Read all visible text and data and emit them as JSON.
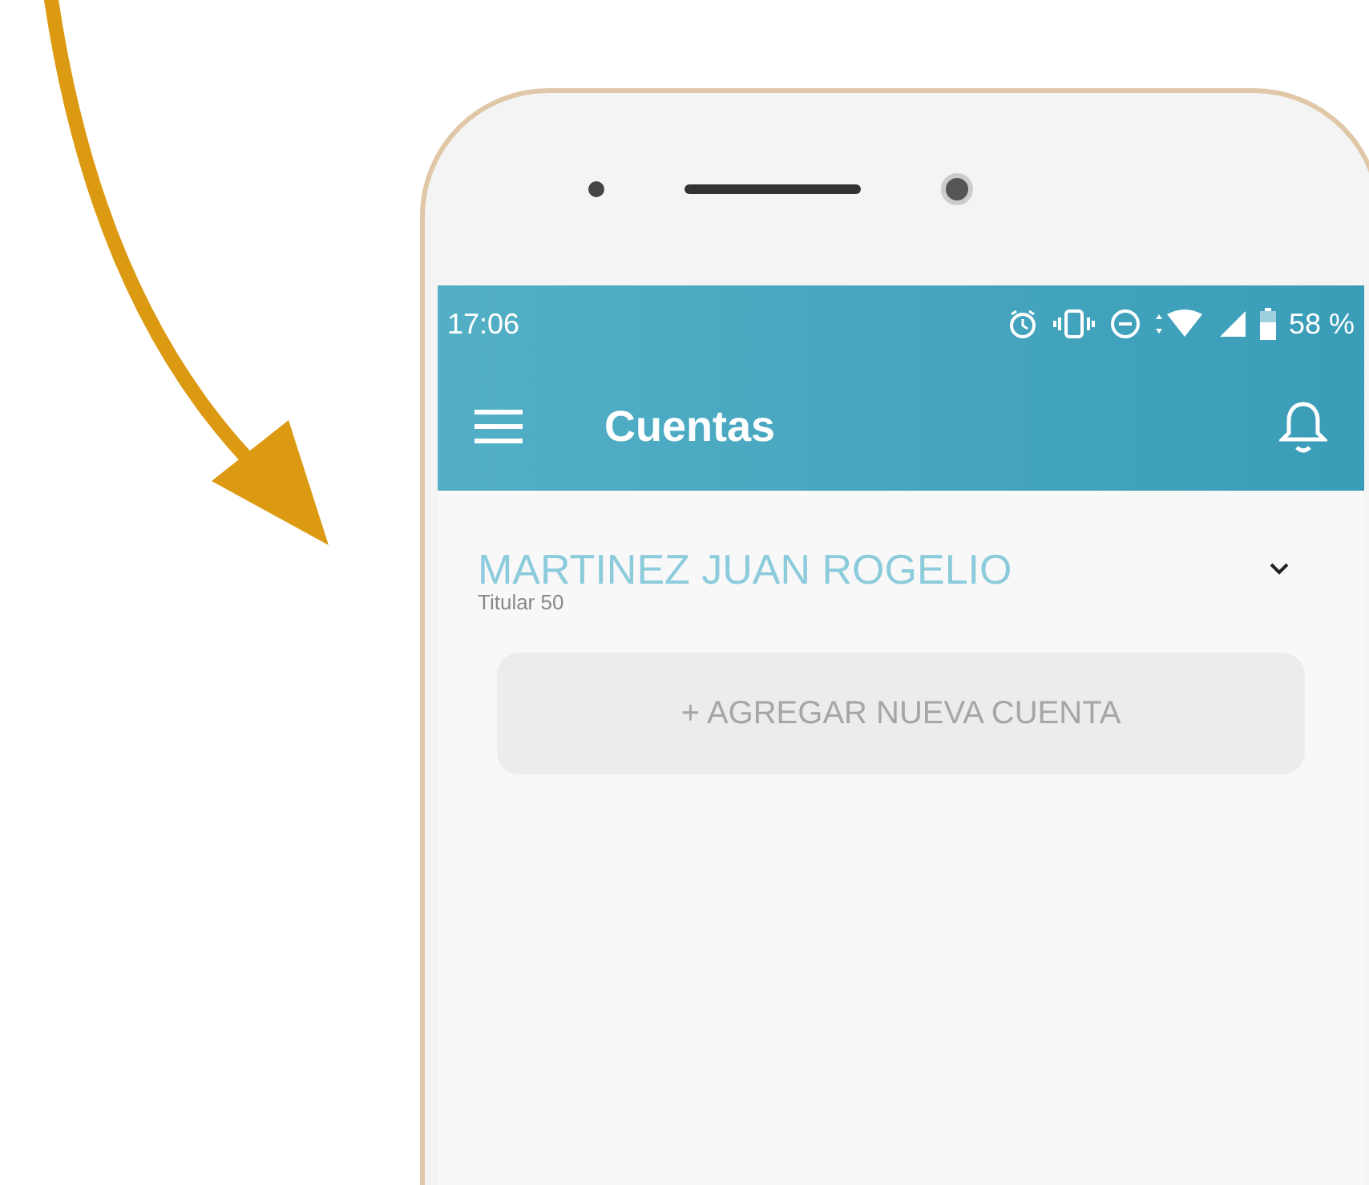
{
  "status_bar": {
    "time": "17:06",
    "battery": "58 %"
  },
  "app_bar": {
    "title": "Cuentas"
  },
  "account": {
    "name": "MARTINEZ JUAN ROGELIO",
    "subtitle": "Titular 50",
    "expanded": false
  },
  "add_button": {
    "label": "+ AGREGAR NUEVA CUENTA",
    "disabled": true
  }
}
